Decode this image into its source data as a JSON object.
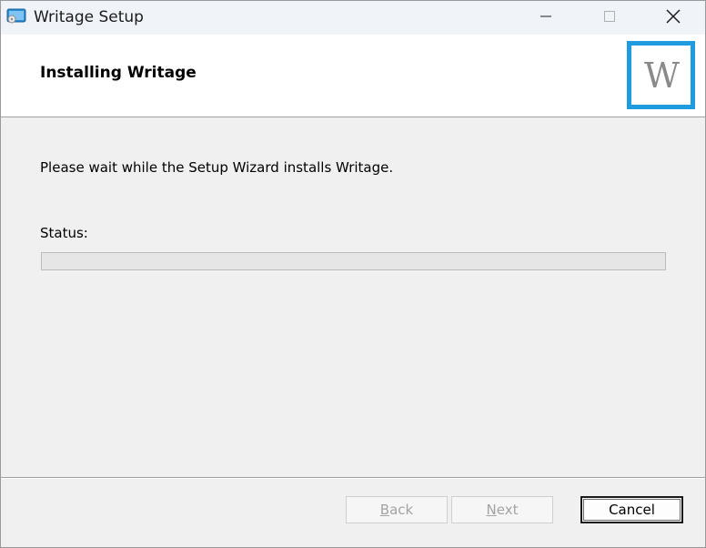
{
  "window": {
    "title": "Writage Setup",
    "titlebar_buttons": [
      "minimize-icon",
      "maximize-icon",
      "close-icon"
    ]
  },
  "header": {
    "title": "Installing Writage",
    "logo_letter": "W",
    "logo_border_color": "#1f9ce0"
  },
  "main": {
    "message": "Please wait while the Setup Wizard installs Writage.",
    "status_label": "Status:",
    "progress_percent": 0
  },
  "footer": {
    "back_label": "Back",
    "next_label": "Next",
    "cancel_label": "Cancel"
  }
}
